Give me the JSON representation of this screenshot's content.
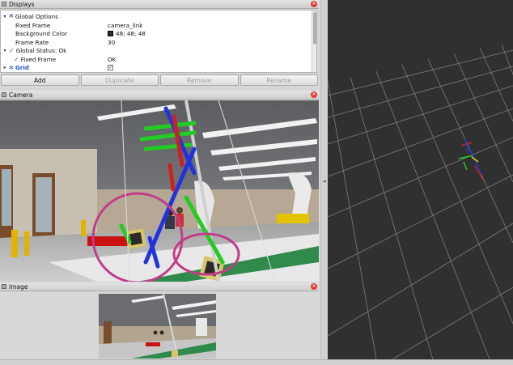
{
  "displays_panel": {
    "title": "Displays",
    "rows": [
      {
        "name": "Global Options",
        "value": ""
      },
      {
        "name": "Fixed Frame",
        "value": "camera_link"
      },
      {
        "name": "Background Color",
        "value": "48; 48; 48"
      },
      {
        "name": "Frame Rate",
        "value": "30"
      },
      {
        "name": "Global Status: Ok",
        "value": ""
      },
      {
        "name": "Fixed Frame",
        "value": "OK"
      },
      {
        "name": "Grid",
        "value": ""
      }
    ],
    "buttons": {
      "add": "Add",
      "duplicate": "Duplicate",
      "remove": "Remove",
      "rename": "Rename"
    }
  },
  "camera_panel": {
    "title": "Camera"
  },
  "image_panel": {
    "title": "Image"
  },
  "colors": {
    "background": "#303030",
    "status_ok": "#2d8a2d",
    "close": "#e03a2f"
  },
  "icons": {
    "panel": "panel-icon",
    "close": "close-icon",
    "gear": "gear-icon",
    "check": "check-icon",
    "caret": "caret-icon"
  }
}
